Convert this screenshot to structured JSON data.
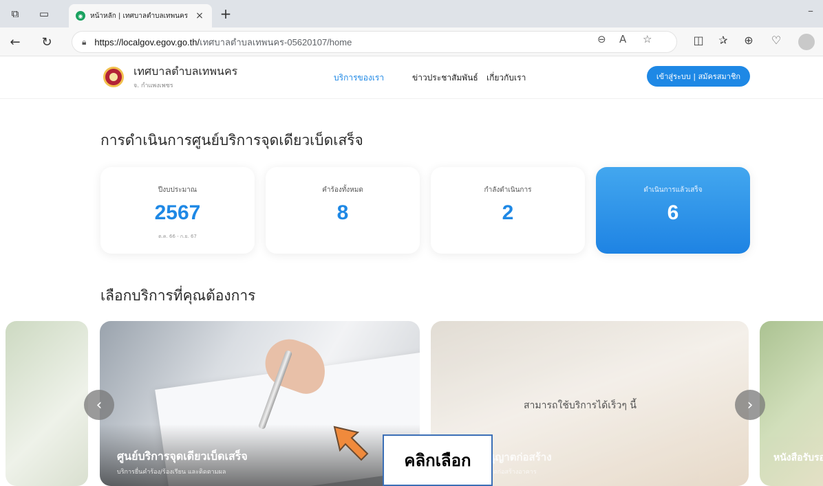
{
  "browser": {
    "tab_title": "หน้าหลัก | เทศบาลตำบลเทพนคร",
    "tab_close": "×",
    "new_tab": "+",
    "minimize": "–",
    "url_host": "https://localgov.egov.go.th/",
    "url_path": "เทศบาลตำบลเทพนคร-05620107/home"
  },
  "site": {
    "name": "เทศบาลตำบลเทพนคร",
    "province": "จ. กำแพงเพชร",
    "nav": [
      "บริการของเรา",
      "ข่าวประชาสัมพันธ์",
      "เกี่ยวกับเรา"
    ],
    "login_label": "เข้าสู่ระบบ | สมัครสมาชิก"
  },
  "stats": {
    "title": "การดำเนินการศูนย์บริการจุดเดียวเบ็ดเสร็จ",
    "cards": [
      {
        "label": "ปีงบประมาณ",
        "value": "2567",
        "sub": "ต.ค. 66 - ก.ย. 67"
      },
      {
        "label": "คำร้องทั้งหมด",
        "value": "8"
      },
      {
        "label": "กำลังดำเนินการ",
        "value": "2"
      },
      {
        "label": "ดำเนินการแล้วเสร็จ",
        "value": "6"
      }
    ]
  },
  "services": {
    "title": "เลือกบริการที่คุณต้องการ",
    "main_slide_title": "ศูนย์บริการจุดเดียวเบ็ดเสร็จ",
    "main_slide_sub": "บริการยื่นคำร้อง/ร้องเรียน และติดตามผล",
    "second_slide_hint": "สามารถใช้บริการได้เร็วๆ นี้",
    "second_slide_title": "ขออนุญาตก่อสร้าง",
    "second_slide_sub": "ขออนุญาตก่อสร้างอาคาร",
    "third_slide_title": "หนังสือรับรอง"
  },
  "annotation": {
    "label": "คลิกเลือก",
    "arrow_color": "#f08a3c"
  },
  "colors": {
    "accent": "#1e88e5"
  }
}
